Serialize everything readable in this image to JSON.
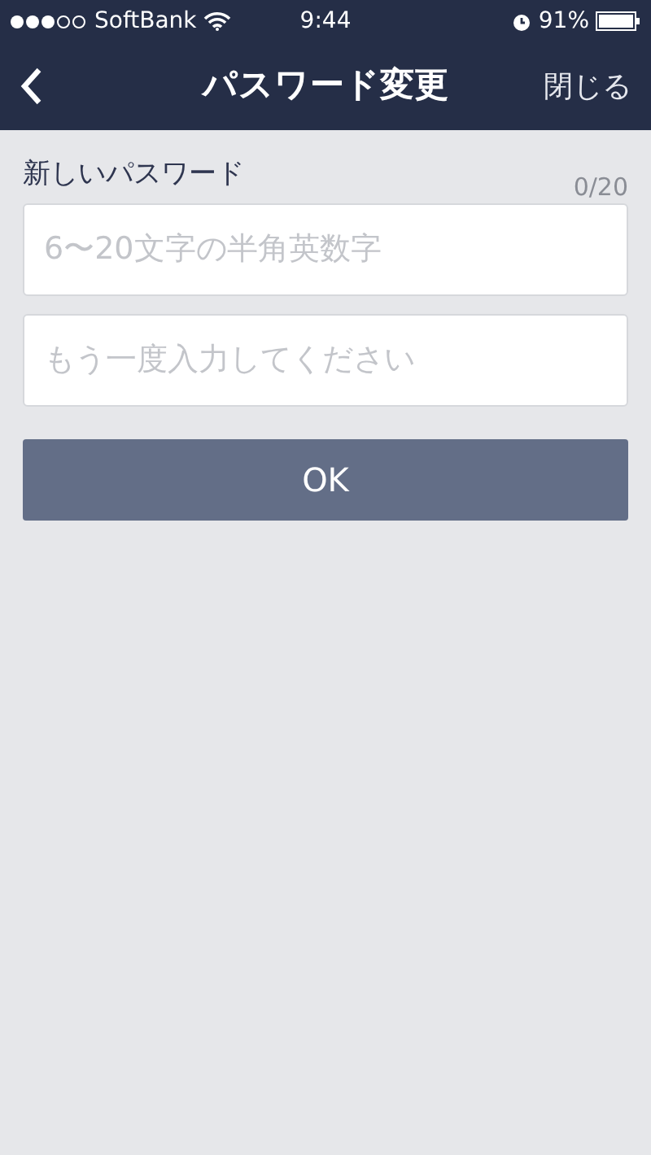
{
  "status_bar": {
    "carrier": "SoftBank",
    "time": "9:44",
    "battery": "91%"
  },
  "nav_bar": {
    "title": "パスワード変更",
    "close": "閉じる"
  },
  "form": {
    "label": "新しいパスワード",
    "counter": "0/20",
    "fields": [
      {
        "placeholder": "6〜20文字の半角英数字"
      },
      {
        "placeholder": "もう一度入力してください"
      }
    ],
    "button": {
      "label": "OK",
      "disabled": true
    }
  }
}
